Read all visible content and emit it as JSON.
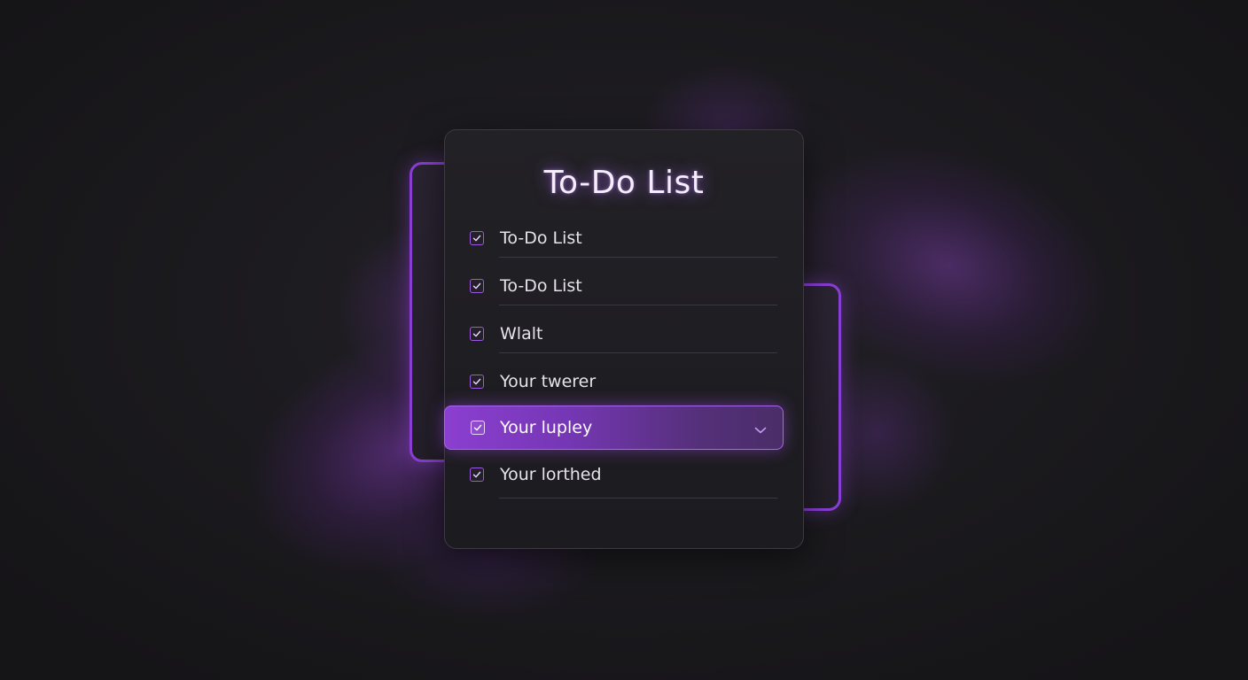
{
  "app": {
    "title": "To-Do List"
  },
  "colors": {
    "accent": "#8a3fd6",
    "selected_row": "#8b3fd0",
    "background": "#1c1b1f",
    "text": "#e6e2ea"
  },
  "todo": {
    "items": [
      {
        "label": "To-Do List",
        "checked": true
      },
      {
        "label": "To-Do List",
        "checked": true
      },
      {
        "label": "Wlalt",
        "checked": true
      },
      {
        "label": "Your twerer",
        "checked": true
      },
      {
        "label": "Your lupley",
        "checked": true,
        "selected": true,
        "icon": "chevron-down-icon"
      },
      {
        "label": "Your lorthed",
        "checked": true
      }
    ]
  }
}
